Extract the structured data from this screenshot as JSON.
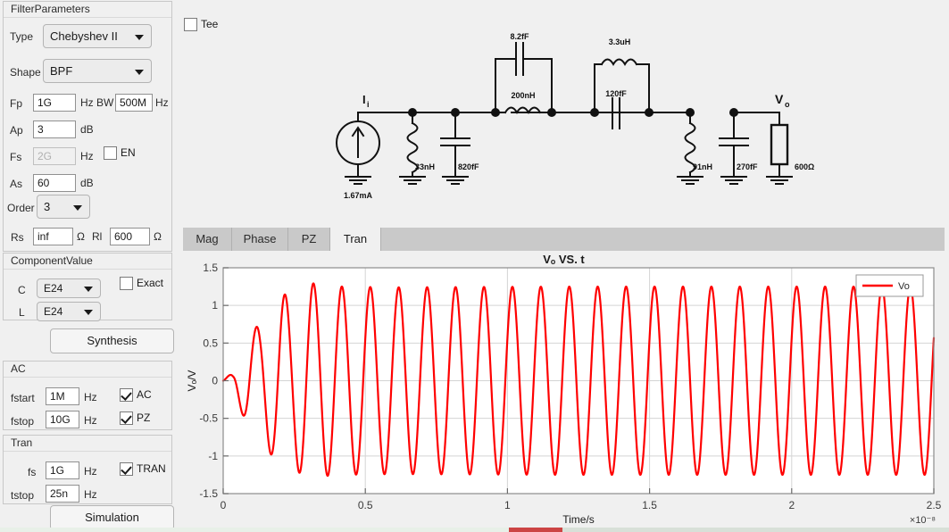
{
  "left_panel": {
    "filter_parameters": {
      "title": "FilterParameters",
      "type_label": "Type",
      "type_value": "Chebyshev II",
      "shape_label": "Shape",
      "shape_value": "BPF",
      "fp_label": "Fp",
      "fp_value": "1G",
      "fp_unit": "Hz",
      "bw_label": "BW",
      "bw_value": "500M",
      "bw_unit": "Hz",
      "ap_label": "Ap",
      "ap_value": "3",
      "ap_unit": "dB",
      "fs_label": "Fs",
      "fs_value": "2G",
      "fs_unit": "Hz",
      "en_label": "EN",
      "en_checked": false,
      "as_label": "As",
      "as_value": "60",
      "as_unit": "dB",
      "order_label": "Order",
      "order_value": "3",
      "rs_label": "Rs",
      "rs_value": "inf",
      "rs_unit": "Ω",
      "rl_label": "Rl",
      "rl_value": "600",
      "rl_unit": "Ω"
    },
    "component_value": {
      "title": "ComponentValue",
      "c_label": "C",
      "c_value": "E24",
      "l_label": "L",
      "l_value": "E24",
      "exact_label": "Exact",
      "exact_checked": false
    },
    "synthesis_button": "Synthesis",
    "ac": {
      "title": "AC",
      "fstart_label": "fstart",
      "fstart_value": "1M",
      "fstart_unit": "Hz",
      "fstop_label": "fstop",
      "fstop_value": "10G",
      "fstop_unit": "Hz",
      "ac_label": "AC",
      "ac_checked": true,
      "pz_label": "PZ",
      "pz_checked": true
    },
    "tran": {
      "title": "Tran",
      "fs_label": "fs",
      "fs_value": "1G",
      "fs_unit": "Hz",
      "tstop_label": "tstop",
      "tstop_value": "25n",
      "tstop_unit": "Hz",
      "tran_label": "TRAN",
      "tran_checked": true
    },
    "simulation_button": "Simulation"
  },
  "schematic": {
    "tee_label": "Tee",
    "tee_checked": false,
    "source_label": "I",
    "source_sub": "i",
    "source_value": "1.67mA",
    "output_label": "V",
    "output_sub": "o",
    "components": [
      {
        "name": "shunt-inductor-1",
        "value": "33nH"
      },
      {
        "name": "shunt-capacitor-1",
        "value": "820fF"
      },
      {
        "name": "series-capacitor-1",
        "value": "8.2fF"
      },
      {
        "name": "series-inductor-1",
        "value": "200nH"
      },
      {
        "name": "series-inductor-2",
        "value": "3.3uH"
      },
      {
        "name": "series-capacitor-2",
        "value": "120fF"
      },
      {
        "name": "shunt-inductor-2",
        "value": "91nH"
      },
      {
        "name": "shunt-capacitor-2",
        "value": "270fF"
      },
      {
        "name": "load-resistor",
        "value": "600Ω"
      }
    ]
  },
  "tabs": [
    {
      "label": "Mag",
      "active": false
    },
    {
      "label": "Phase",
      "active": false
    },
    {
      "label": "PZ",
      "active": false
    },
    {
      "label": "Tran",
      "active": true
    }
  ],
  "chart_data": {
    "type": "line",
    "title": "Vₒ VS. t",
    "xlabel": "Time/s",
    "ylabel": "Vₒ/V",
    "x_exponent": "×10⁻⁸",
    "xlim": [
      0,
      2.5e-08
    ],
    "ylim": [
      -1.5,
      1.5
    ],
    "xticks": [
      0,
      0.5,
      1,
      1.5,
      2,
      2.5
    ],
    "xtick_labels": [
      "0",
      "0.5",
      "1",
      "1.5",
      "2",
      "2.5"
    ],
    "yticks": [
      -1.5,
      -1,
      -0.5,
      0,
      0.5,
      1,
      1.5
    ],
    "ytick_labels": [
      "-1.5",
      "-1",
      "-0.5",
      "0",
      "0.5",
      "1",
      "1.5"
    ],
    "grid": true,
    "legend": {
      "position": "top-right",
      "entries": [
        {
          "name": "Vo",
          "color": "#ff0000"
        }
      ]
    },
    "series": [
      {
        "name": "Vo",
        "color": "#ff0000",
        "line_width": 2.2,
        "description": "Transient step-up of a band-pass filter: damped ringing envelope growing from 0 to steady-state amplitude 1.25 V, carrier frequency 1 GHz over 25 ns.",
        "carrier_freq_hz": 1000000000.0,
        "steady_amplitude": 1.25,
        "settling_time_s": 5e-09,
        "envelope_samples": [
          {
            "t_ns": 0.0,
            "amp": 0.0
          },
          {
            "t_ns": 0.35,
            "amp": 0.12
          },
          {
            "t_ns": 0.9,
            "amp": 0.66
          },
          {
            "t_ns": 1.3,
            "amp": 0.74
          },
          {
            "t_ns": 2.0,
            "amp": 1.18
          },
          {
            "t_ns": 2.4,
            "amp": 1.1
          },
          {
            "t_ns": 2.9,
            "amp": 1.32
          },
          {
            "t_ns": 3.4,
            "amp": 1.27
          },
          {
            "t_ns": 4.2,
            "amp": 1.25
          },
          {
            "t_ns": 6.0,
            "amp": 1.24
          },
          {
            "t_ns": 12.0,
            "amp": 1.25
          },
          {
            "t_ns": 25.0,
            "amp": 1.25
          }
        ]
      }
    ]
  }
}
